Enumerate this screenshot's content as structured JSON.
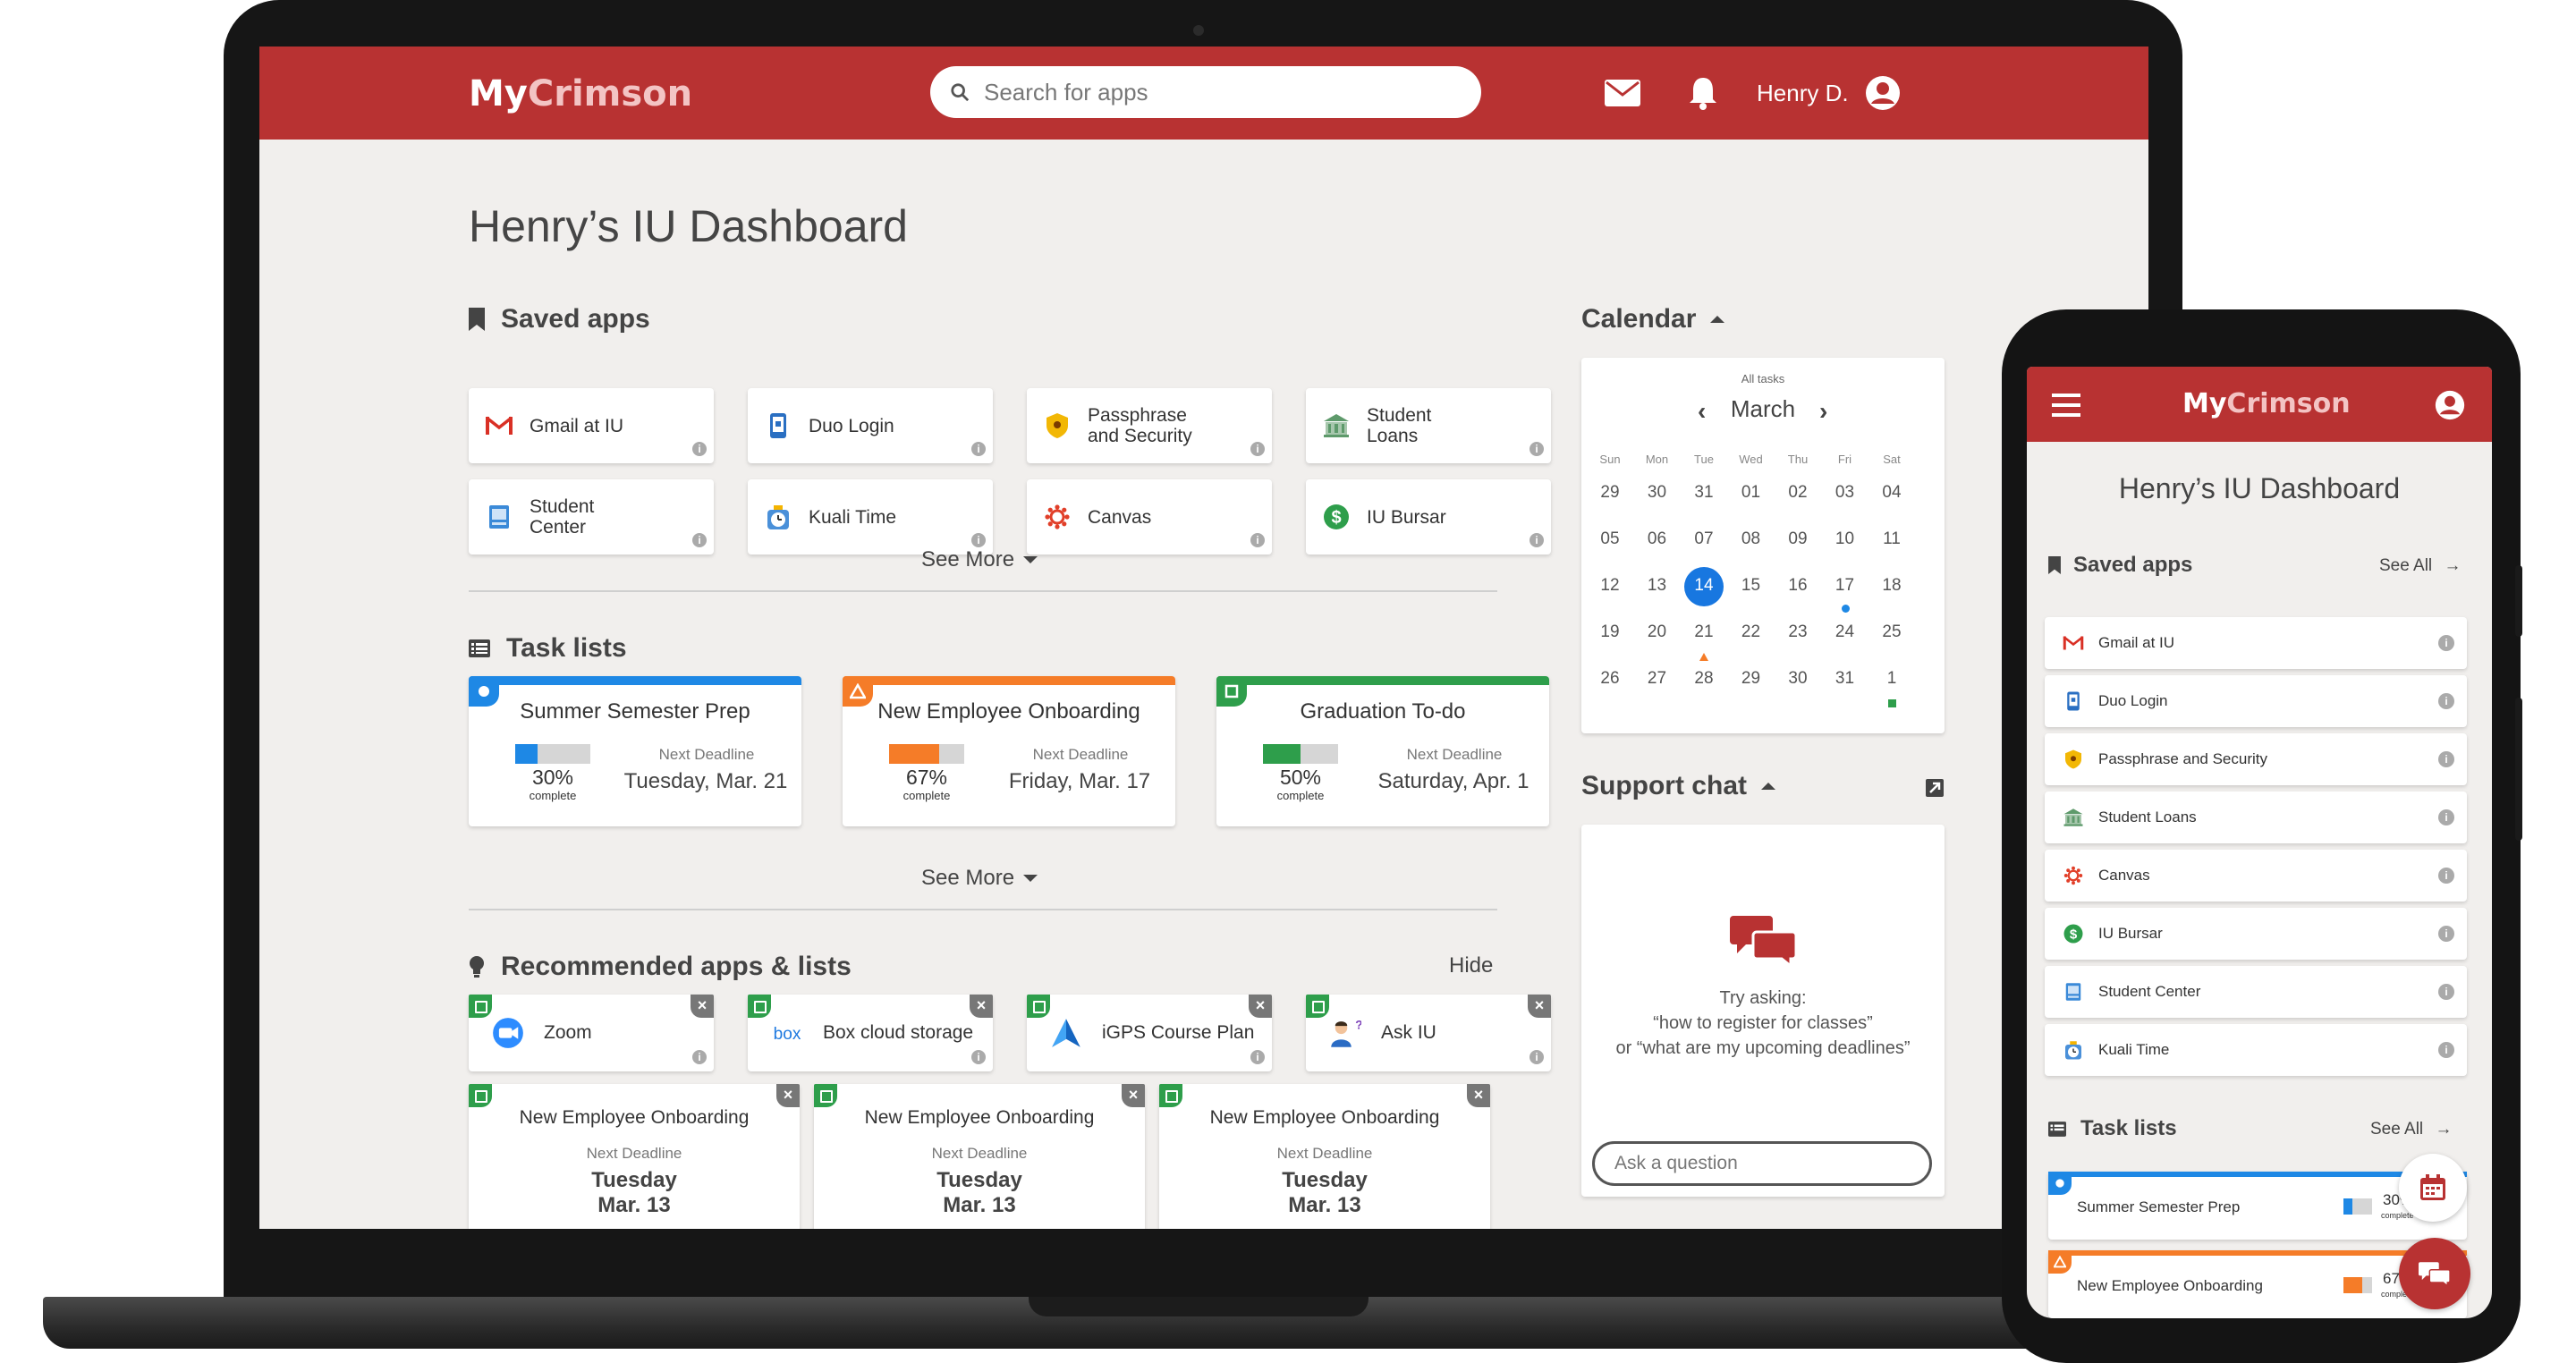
{
  "colors": {
    "brand": "#b83232",
    "blue": "#1e88e5",
    "orange": "#f57c28",
    "green": "#2e9e4b"
  },
  "header": {
    "logo_my": "My",
    "logo_crimson": "Crimson",
    "search_placeholder": "Search for apps",
    "user_name": "Henry D."
  },
  "dashboard": {
    "title": "Henry’s IU Dashboard",
    "saved_apps": {
      "heading": "Saved apps",
      "items": [
        {
          "line1": "Gmail at IU",
          "line2": "",
          "icon": "gmail-icon"
        },
        {
          "line1": "Duo Login",
          "line2": "",
          "icon": "duo-icon"
        },
        {
          "line1": "Passphrase",
          "line2": "and Security",
          "icon": "shield-icon"
        },
        {
          "line1": "Student",
          "line2": "Loans",
          "icon": "bank-icon"
        },
        {
          "line1": "Student",
          "line2": "Center",
          "icon": "student-center-icon"
        },
        {
          "line1": "Kuali Time",
          "line2": "",
          "icon": "clock-icon"
        },
        {
          "line1": "Canvas",
          "line2": "",
          "icon": "canvas-icon"
        },
        {
          "line1": "IU Bursar",
          "line2": "",
          "icon": "dollar-icon"
        }
      ],
      "see_more": "See More"
    },
    "task_lists": {
      "heading": "Task lists",
      "items": [
        {
          "title": "Summer Semester Prep",
          "percent": "30%",
          "progress": 0.3,
          "complete": "complete",
          "next_label": "Next Deadline",
          "next_date": "Tuesday, Mar. 21",
          "color": "#1e88e5"
        },
        {
          "title": "New Employee Onboarding",
          "percent": "67%",
          "progress": 0.67,
          "complete": "complete",
          "next_label": "Next Deadline",
          "next_date": "Friday, Mar. 17",
          "color": "#f57c28"
        },
        {
          "title": "Graduation To-do",
          "percent": "50%",
          "progress": 0.5,
          "complete": "complete",
          "next_label": "Next Deadline",
          "next_date": "Saturday, Apr. 1",
          "color": "#2e9e4b"
        }
      ],
      "see_more": "See More"
    },
    "recommended": {
      "heading": "Recommended apps & lists",
      "hide": "Hide",
      "apps": [
        {
          "label": "Zoom",
          "icon": "zoom-icon"
        },
        {
          "label": "Box cloud storage",
          "icon": "box-icon",
          "logo_text": "box"
        },
        {
          "label": "iGPS Course Plan",
          "icon": "igps-icon"
        },
        {
          "label": "Ask IU",
          "icon": "ask-iu-icon"
        }
      ],
      "lists": [
        {
          "title": "New Employee Onboarding",
          "next_label": "Next Deadline",
          "day": "Tuesday",
          "date": "Mar. 13"
        },
        {
          "title": "New Employee Onboarding",
          "next_label": "Next Deadline",
          "day": "Tuesday",
          "date": "Mar. 13"
        },
        {
          "title": "New Employee Onboarding",
          "next_label": "Next Deadline",
          "day": "Tuesday",
          "date": "Mar. 13"
        }
      ]
    }
  },
  "calendar": {
    "heading": "Calendar",
    "filter": "All tasks",
    "month": "March",
    "weekdays": [
      "Sun",
      "Mon",
      "Tue",
      "Wed",
      "Thu",
      "Fri",
      "Sat"
    ],
    "weeks": [
      [
        "29",
        "30",
        "31",
        "01",
        "02",
        "03",
        "04"
      ],
      [
        "05",
        "06",
        "07",
        "08",
        "09",
        "10",
        "11"
      ],
      [
        "12",
        "13",
        "14",
        "15",
        "16",
        "17",
        "18"
      ],
      [
        "19",
        "20",
        "21",
        "22",
        "23",
        "24",
        "25"
      ],
      [
        "26",
        "27",
        "28",
        "29",
        "30",
        "31",
        "1"
      ]
    ],
    "today": "14"
  },
  "support_chat": {
    "heading": "Support chat",
    "try": "Try asking:",
    "example1": "“how to register for classes”",
    "example2": "or “what are my upcoming deadlines”",
    "placeholder": "Ask a question"
  },
  "phone": {
    "logo_my": "My",
    "logo_crimson": "Crimson",
    "title": "Henry’s IU Dashboard",
    "saved_heading": "Saved apps",
    "see_all": "See All",
    "apps": [
      {
        "label": "Gmail at IU",
        "icon": "gmail-icon"
      },
      {
        "label": "Duo Login",
        "icon": "duo-icon"
      },
      {
        "label": "Passphrase and Security",
        "icon": "shield-icon"
      },
      {
        "label": "Student Loans",
        "icon": "bank-icon"
      },
      {
        "label": "Canvas",
        "icon": "canvas-icon"
      },
      {
        "label": "IU Bursar",
        "icon": "dollar-icon"
      },
      {
        "label": "Student Center",
        "icon": "student-center-icon"
      },
      {
        "label": "Kuali Time",
        "icon": "clock-icon"
      }
    ],
    "task_heading": "Task lists",
    "task_see_all": "See All",
    "tasks": [
      {
        "title": "Summer Semester Prep",
        "percent": "30%",
        "progress": 0.3,
        "complete": "complete",
        "color": "#1e88e5"
      },
      {
        "title": "New Employee Onboarding",
        "percent": "67%",
        "progress": 0.67,
        "complete": "complete",
        "color": "#f57c28"
      }
    ]
  }
}
